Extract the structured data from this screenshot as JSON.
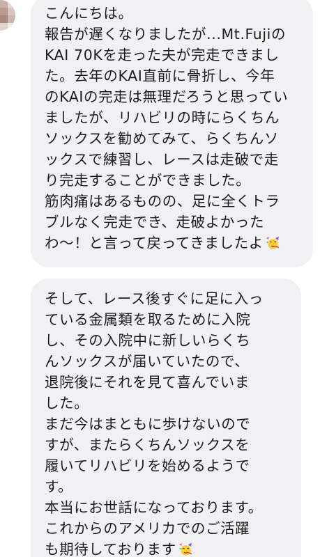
{
  "conversation": {
    "messages": [
      {
        "lines": [
          "こんにちは。",
          "報告が遅くなりましたが...Mt.Fujiの",
          "KAI 70Kを走った夫が完走できまし",
          "た。去年のKAI直前に骨折し、今年",
          "のKAIの完走は無理だろうと思ってい",
          "ましたが、リハビリの時にらくちん",
          "ソックスを勧めてみて、らくちんソ",
          "ックスで練習し、レースは走破で走",
          "り完走することができました。",
          "筋肉痛はあるものの、足に全くトラ",
          "ブルなく完走でき、走破よかった",
          "わ〜！と言って戻ってきましたよ"
        ],
        "trailing_emoji": "partying-face-emoji"
      },
      {
        "lines": [
          "そして、レース後すぐに足に入っ",
          "ている金属類を取るために入院",
          "し、その入院中に新しいらくち",
          "んソックスが届いていたので、",
          "退院後にそれを見て喜んでいま",
          "した。",
          "まだ今はまともに歩けないので",
          "すが、またらくちんソックスを",
          "履いてリハビリを始めるようで",
          "す。",
          "本当にお世話になっております。",
          "これからのアメリカでのご活躍",
          "も期待しております"
        ],
        "trailing_emoji": "partying-face-emoji"
      }
    ]
  },
  "colors": {
    "bubble_background": "#f1f1f3",
    "text": "#1c1c1e",
    "page_background": "#ffffff"
  }
}
